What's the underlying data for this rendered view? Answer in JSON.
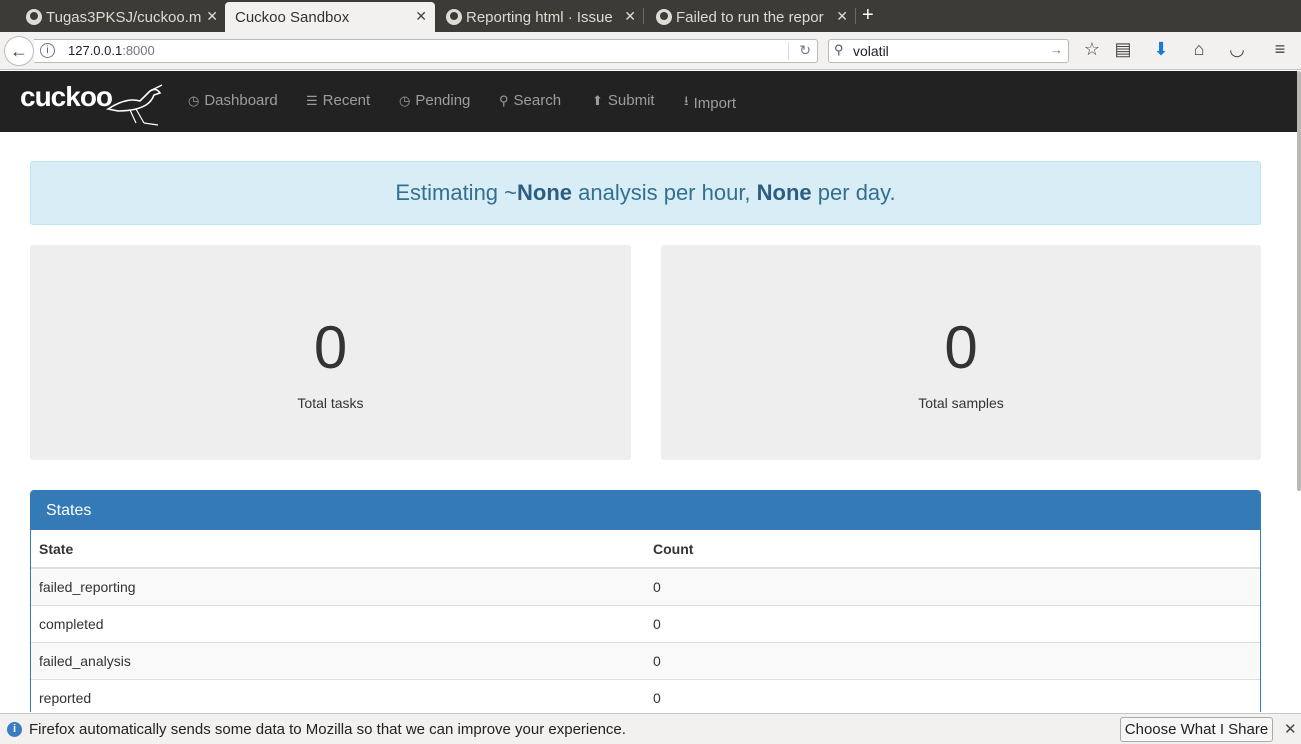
{
  "tabs": [
    {
      "label": "Tugas3PKSJ/cuckoo.m",
      "active": false
    },
    {
      "label": "Cuckoo Sandbox",
      "active": true
    },
    {
      "label": "Reporting html · Issue",
      "active": false
    },
    {
      "label": "Failed to run the repor",
      "active": false
    }
  ],
  "url": {
    "host": "127.0.0.1",
    "port": ":8000"
  },
  "search": {
    "value": "volatil"
  },
  "app": {
    "logo": "cuckoo"
  },
  "nav": [
    {
      "icon": "dashboard-icon",
      "glyph": "◷",
      "label": "Dashboard"
    },
    {
      "icon": "list-icon",
      "glyph": "☰",
      "label": "Recent"
    },
    {
      "icon": "clock-icon",
      "glyph": "◷",
      "label": "Pending"
    },
    {
      "icon": "search-icon",
      "glyph": "⚲",
      "label": "Search"
    },
    {
      "icon": "upload-icon",
      "glyph": "⬆",
      "label": "Submit"
    },
    {
      "icon": "import-icon",
      "glyph": "⭳",
      "label": "Import"
    }
  ],
  "estimate": {
    "prefix": "Estimating ~",
    "per_hour": "None",
    "mid": " analysis per hour, ",
    "per_day": "None",
    "suffix": " per day."
  },
  "stats": {
    "tasks": {
      "value": "0",
      "label": "Total tasks"
    },
    "samples": {
      "value": "0",
      "label": "Total samples"
    }
  },
  "states": {
    "title": "States",
    "headers": [
      "State",
      "Count"
    ],
    "rows": [
      {
        "state": "failed_reporting",
        "count": "0"
      },
      {
        "state": "completed",
        "count": "0"
      },
      {
        "state": "failed_analysis",
        "count": "0"
      },
      {
        "state": "reported",
        "count": "0"
      }
    ]
  },
  "notification": {
    "message": "Firefox automatically sends some data to Mozilla so that we can improve your experience.",
    "button": "Choose What I Share"
  },
  "colors": {
    "navbar": "#222222",
    "primary": "#337ab7",
    "alert_bg": "#d9edf7",
    "alert_text": "#31708f"
  }
}
